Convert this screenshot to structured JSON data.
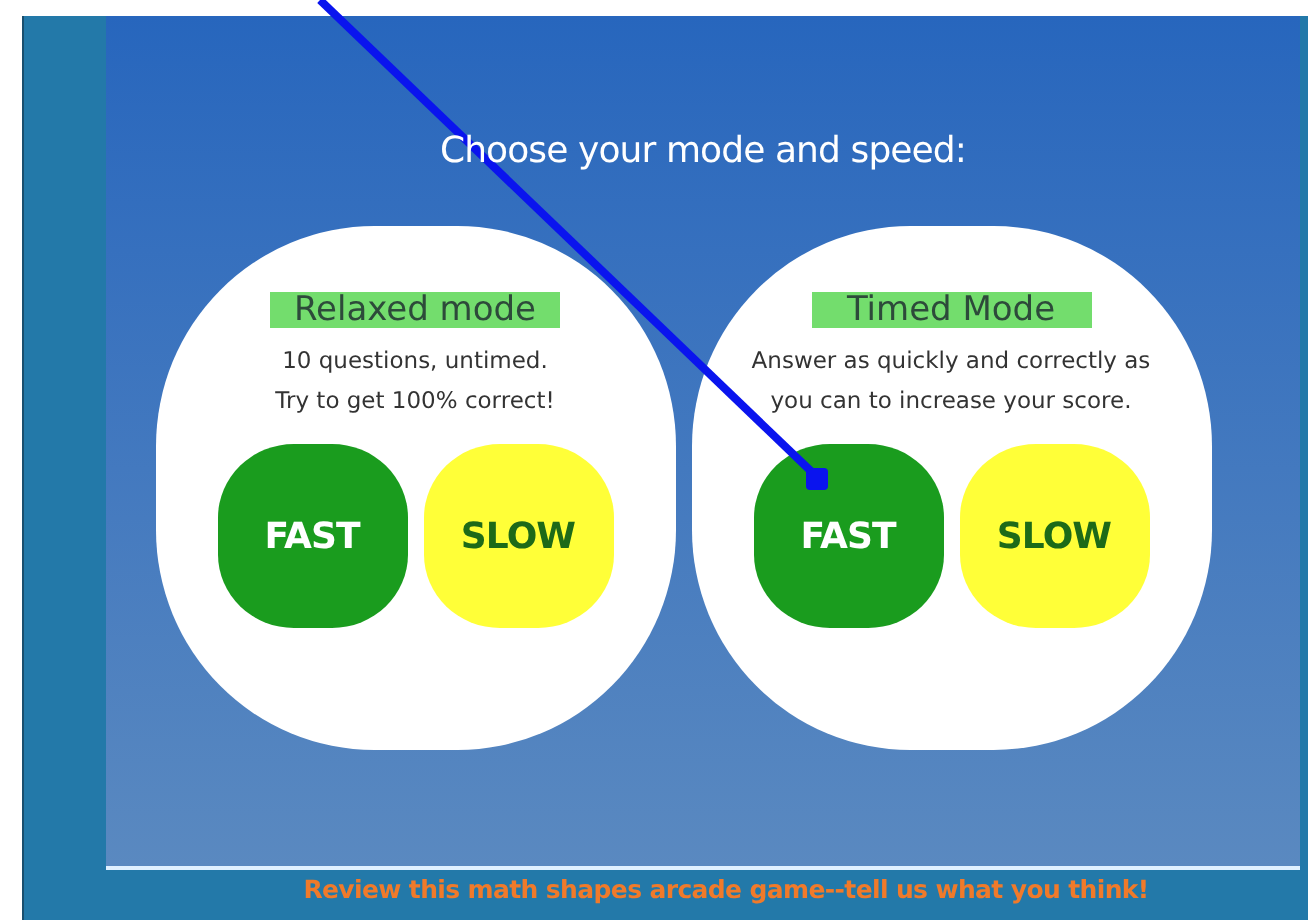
{
  "heading": "Choose your mode and speed:",
  "modes": [
    {
      "title": "Relaxed mode",
      "description": [
        "10 questions, untimed.",
        "Try to get 100% correct!"
      ],
      "buttons": [
        {
          "label": "FAST",
          "kind": "fast"
        },
        {
          "label": "SLOW",
          "kind": "slow"
        }
      ]
    },
    {
      "title": "Timed Mode",
      "description": [
        "Answer as quickly and correctly as",
        "you can to increase your score."
      ],
      "buttons": [
        {
          "label": "FAST",
          "kind": "fast"
        },
        {
          "label": "SLOW",
          "kind": "slow"
        }
      ]
    }
  ],
  "footer": "Review this math shapes arcade game--tell us what you think!"
}
